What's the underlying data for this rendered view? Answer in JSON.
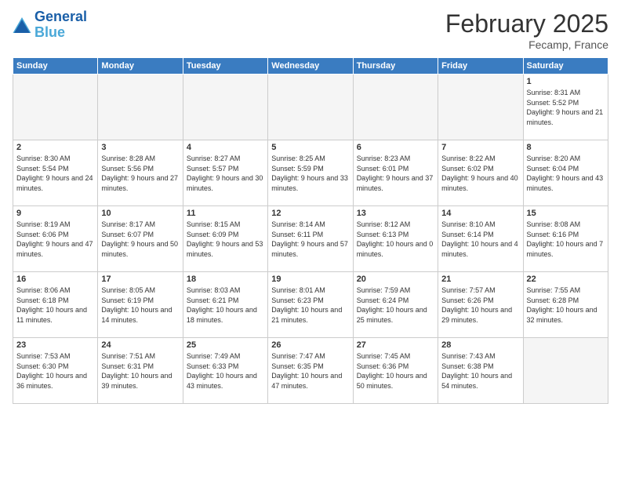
{
  "header": {
    "logo_general": "General",
    "logo_blue": "Blue",
    "month_title": "February 2025",
    "location": "Fecamp, France"
  },
  "days_of_week": [
    "Sunday",
    "Monday",
    "Tuesday",
    "Wednesday",
    "Thursday",
    "Friday",
    "Saturday"
  ],
  "weeks": [
    [
      {
        "day": "",
        "info": ""
      },
      {
        "day": "",
        "info": ""
      },
      {
        "day": "",
        "info": ""
      },
      {
        "day": "",
        "info": ""
      },
      {
        "day": "",
        "info": ""
      },
      {
        "day": "",
        "info": ""
      },
      {
        "day": "1",
        "info": "Sunrise: 8:31 AM\nSunset: 5:52 PM\nDaylight: 9 hours and 21 minutes."
      }
    ],
    [
      {
        "day": "2",
        "info": "Sunrise: 8:30 AM\nSunset: 5:54 PM\nDaylight: 9 hours and 24 minutes."
      },
      {
        "day": "3",
        "info": "Sunrise: 8:28 AM\nSunset: 5:56 PM\nDaylight: 9 hours and 27 minutes."
      },
      {
        "day": "4",
        "info": "Sunrise: 8:27 AM\nSunset: 5:57 PM\nDaylight: 9 hours and 30 minutes."
      },
      {
        "day": "5",
        "info": "Sunrise: 8:25 AM\nSunset: 5:59 PM\nDaylight: 9 hours and 33 minutes."
      },
      {
        "day": "6",
        "info": "Sunrise: 8:23 AM\nSunset: 6:01 PM\nDaylight: 9 hours and 37 minutes."
      },
      {
        "day": "7",
        "info": "Sunrise: 8:22 AM\nSunset: 6:02 PM\nDaylight: 9 hours and 40 minutes."
      },
      {
        "day": "8",
        "info": "Sunrise: 8:20 AM\nSunset: 6:04 PM\nDaylight: 9 hours and 43 minutes."
      }
    ],
    [
      {
        "day": "9",
        "info": "Sunrise: 8:19 AM\nSunset: 6:06 PM\nDaylight: 9 hours and 47 minutes."
      },
      {
        "day": "10",
        "info": "Sunrise: 8:17 AM\nSunset: 6:07 PM\nDaylight: 9 hours and 50 minutes."
      },
      {
        "day": "11",
        "info": "Sunrise: 8:15 AM\nSunset: 6:09 PM\nDaylight: 9 hours and 53 minutes."
      },
      {
        "day": "12",
        "info": "Sunrise: 8:14 AM\nSunset: 6:11 PM\nDaylight: 9 hours and 57 minutes."
      },
      {
        "day": "13",
        "info": "Sunrise: 8:12 AM\nSunset: 6:13 PM\nDaylight: 10 hours and 0 minutes."
      },
      {
        "day": "14",
        "info": "Sunrise: 8:10 AM\nSunset: 6:14 PM\nDaylight: 10 hours and 4 minutes."
      },
      {
        "day": "15",
        "info": "Sunrise: 8:08 AM\nSunset: 6:16 PM\nDaylight: 10 hours and 7 minutes."
      }
    ],
    [
      {
        "day": "16",
        "info": "Sunrise: 8:06 AM\nSunset: 6:18 PM\nDaylight: 10 hours and 11 minutes."
      },
      {
        "day": "17",
        "info": "Sunrise: 8:05 AM\nSunset: 6:19 PM\nDaylight: 10 hours and 14 minutes."
      },
      {
        "day": "18",
        "info": "Sunrise: 8:03 AM\nSunset: 6:21 PM\nDaylight: 10 hours and 18 minutes."
      },
      {
        "day": "19",
        "info": "Sunrise: 8:01 AM\nSunset: 6:23 PM\nDaylight: 10 hours and 21 minutes."
      },
      {
        "day": "20",
        "info": "Sunrise: 7:59 AM\nSunset: 6:24 PM\nDaylight: 10 hours and 25 minutes."
      },
      {
        "day": "21",
        "info": "Sunrise: 7:57 AM\nSunset: 6:26 PM\nDaylight: 10 hours and 29 minutes."
      },
      {
        "day": "22",
        "info": "Sunrise: 7:55 AM\nSunset: 6:28 PM\nDaylight: 10 hours and 32 minutes."
      }
    ],
    [
      {
        "day": "23",
        "info": "Sunrise: 7:53 AM\nSunset: 6:30 PM\nDaylight: 10 hours and 36 minutes."
      },
      {
        "day": "24",
        "info": "Sunrise: 7:51 AM\nSunset: 6:31 PM\nDaylight: 10 hours and 39 minutes."
      },
      {
        "day": "25",
        "info": "Sunrise: 7:49 AM\nSunset: 6:33 PM\nDaylight: 10 hours and 43 minutes."
      },
      {
        "day": "26",
        "info": "Sunrise: 7:47 AM\nSunset: 6:35 PM\nDaylight: 10 hours and 47 minutes."
      },
      {
        "day": "27",
        "info": "Sunrise: 7:45 AM\nSunset: 6:36 PM\nDaylight: 10 hours and 50 minutes."
      },
      {
        "day": "28",
        "info": "Sunrise: 7:43 AM\nSunset: 6:38 PM\nDaylight: 10 hours and 54 minutes."
      },
      {
        "day": "",
        "info": ""
      }
    ]
  ]
}
